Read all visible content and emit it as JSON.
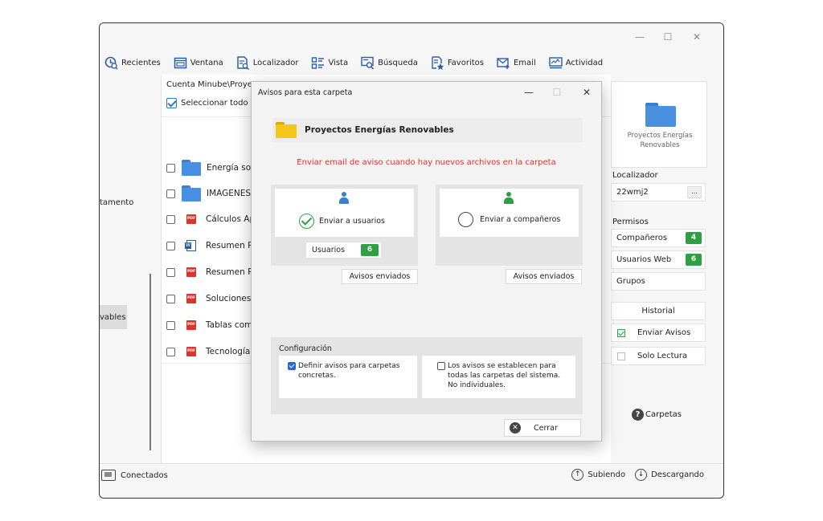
{
  "toolbar": {
    "items": [
      {
        "label": "Recientes",
        "icon": "clock-search-icon"
      },
      {
        "label": "Ventana",
        "icon": "window-icon"
      },
      {
        "label": "Localizador",
        "icon": "document-search-icon"
      },
      {
        "label": "Vista",
        "icon": "list-view-icon"
      },
      {
        "label": "Búsqueda",
        "icon": "search-box-icon"
      },
      {
        "label": "Favoritos",
        "icon": "favorite-list-icon"
      },
      {
        "label": "Email",
        "icon": "email-icon"
      },
      {
        "label": "Actividad",
        "icon": "activity-monitor-icon"
      }
    ]
  },
  "left_panel": {
    "items": [
      "tamento",
      "vables"
    ]
  },
  "main": {
    "breadcrumb": "Cuenta Minube\\Proyect",
    "select_all_label": "Seleccionar todo",
    "files": [
      {
        "name": "Energía solar",
        "type": "folder"
      },
      {
        "name": "IMAGENES",
        "type": "folder"
      },
      {
        "name": "Cálculos Apro",
        "type": "pdf"
      },
      {
        "name": "Resumen Pro",
        "type": "doc"
      },
      {
        "name": "Resumen Pro",
        "type": "pdf"
      },
      {
        "name": "Soluciones A",
        "type": "pdf"
      },
      {
        "name": "Tablas comp",
        "type": "pdf"
      },
      {
        "name": "Tecnología P",
        "type": "pdf"
      }
    ]
  },
  "right_panel": {
    "folder_label": "Proyectos Energías Renovables",
    "localizador_label": "Localizador",
    "localizador_value": "22wmj2",
    "dots_label": "...",
    "permisos_label": "Permisos",
    "companeros_label": "Compañeros",
    "companeros_count": "4",
    "usuarios_web_label": "Usuarios Web",
    "usuarios_web_count": "6",
    "grupos_label": "Grupos",
    "historial_label": "Historial",
    "enviar_avisos_label": "Enviar Avisos",
    "solo_lectura_label": "Solo Lectura",
    "carpetas_label": "Carpetas"
  },
  "status": {
    "connected": "Conectados",
    "uploading": "Subiendo",
    "downloading": "Descargando"
  },
  "dialog": {
    "title": "Avisos para esta carpeta",
    "folder_name": "Proyectos Energías Renovables",
    "notice_text": "Enviar email de aviso cuando hay nuevos archivos en la carpeta",
    "send_users_label": "Enviar a usuarios",
    "send_colleagues_label": "Enviar a compañeros",
    "users_label": "Usuarios",
    "users_count": "6",
    "sent_notices_label": "Avisos enviados",
    "config_title": "Configuración",
    "config_option_1": "Definir avisos para carpetas concretas.",
    "config_option_2": "Los avisos se establecen para todas las carpetas del sistema. No individuales.",
    "close_label": "Cerrar"
  },
  "colors": {
    "accent_blue": "#2a78c8",
    "green_badge": "#2ea043",
    "notice_red": "#d9352a",
    "folder_yellow": "#f5c518",
    "folder_blue": "#4a90e0",
    "user_blue": "#3a7fd1",
    "user_green": "#2ea043"
  }
}
